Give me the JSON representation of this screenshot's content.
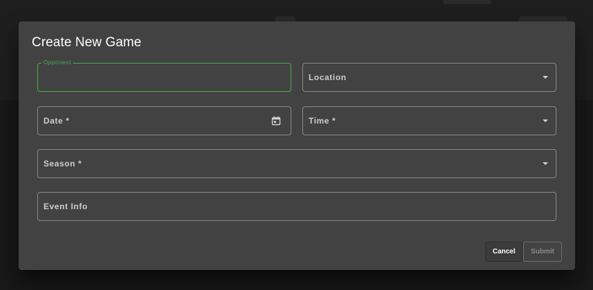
{
  "dialog": {
    "title": "Create New Game"
  },
  "fields": {
    "opponent": {
      "label": "Opponent",
      "value": ""
    },
    "location": {
      "label": "Location"
    },
    "date": {
      "label": "Date *"
    },
    "time": {
      "label": "Time *"
    },
    "season": {
      "label": "Season *"
    },
    "event_info": {
      "label": "Event Info"
    }
  },
  "actions": {
    "cancel_label": "Cancel",
    "submit_label": "Submit"
  },
  "colors": {
    "accent": "#4caf50",
    "dialog_bg": "#424242",
    "page_bg": "#1f1f1f"
  },
  "icons": {
    "date": "calendar-icon",
    "dropdown": "chevron-down-icon"
  }
}
